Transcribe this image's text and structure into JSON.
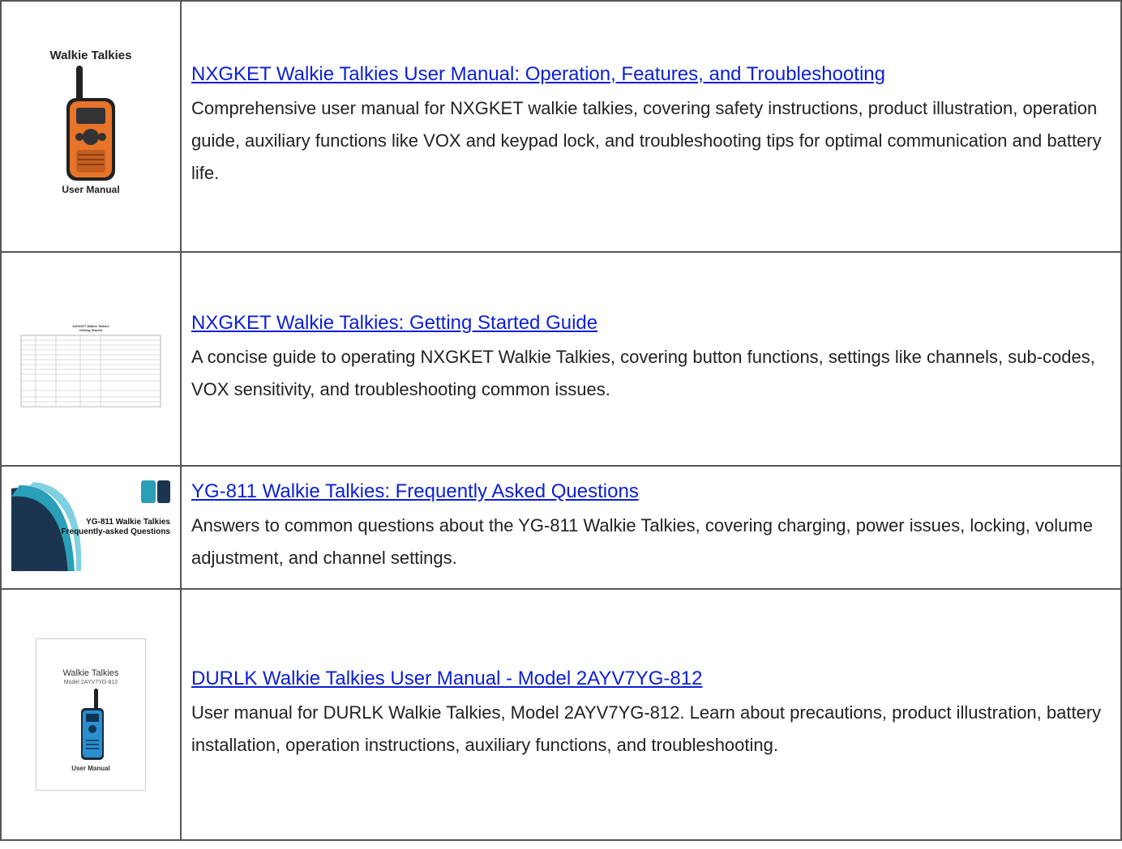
{
  "items": [
    {
      "thumb": {
        "heading": "Walkie Talkies",
        "footer": "User Manual",
        "device_color": "#e8742a"
      },
      "title": "NXGKET Walkie Talkies User Manual: Operation, Features, and Troubleshooting",
      "summary": "Comprehensive user manual for NXGKET walkie talkies, covering safety instructions, product illustration, operation guide, auxiliary functions like VOX and keypad lock, and troubleshooting tips for optimal communication and battery life."
    },
    {
      "thumb": {
        "heading": "NXGKET Walkie Talkies",
        "subheading": "Getting Started"
      },
      "title": "NXGKET Walkie Talkies: Getting Started Guide",
      "summary": "A concise guide to operating NXGKET Walkie Talkies, covering button functions, settings like channels, sub-codes, VOX sensitivity, and troubleshooting common issues."
    },
    {
      "thumb": {
        "line1": "YG-811 Walkie Talkies",
        "line2": "Frequently-asked Questions",
        "accent": "#2a9fb8",
        "dark": "#1b3550"
      },
      "title": "YG-811 Walkie Talkies: Frequently Asked Questions",
      "summary": "Answers to common questions about the YG-811 Walkie Talkies, covering charging, power issues, locking, volume adjustment, and channel settings."
    },
    {
      "thumb": {
        "heading": "Walkie Talkies",
        "model": "Model 2AYV7YG-812",
        "footer": "User Manual",
        "device_color": "#2a8fd0"
      },
      "title": "DURLK Walkie Talkies User Manual - Model 2AYV7YG-812",
      "summary": "User manual for DURLK Walkie Talkies, Model 2AYV7YG-812. Learn about precautions, product illustration, battery installation, operation instructions, auxiliary functions, and troubleshooting."
    }
  ]
}
